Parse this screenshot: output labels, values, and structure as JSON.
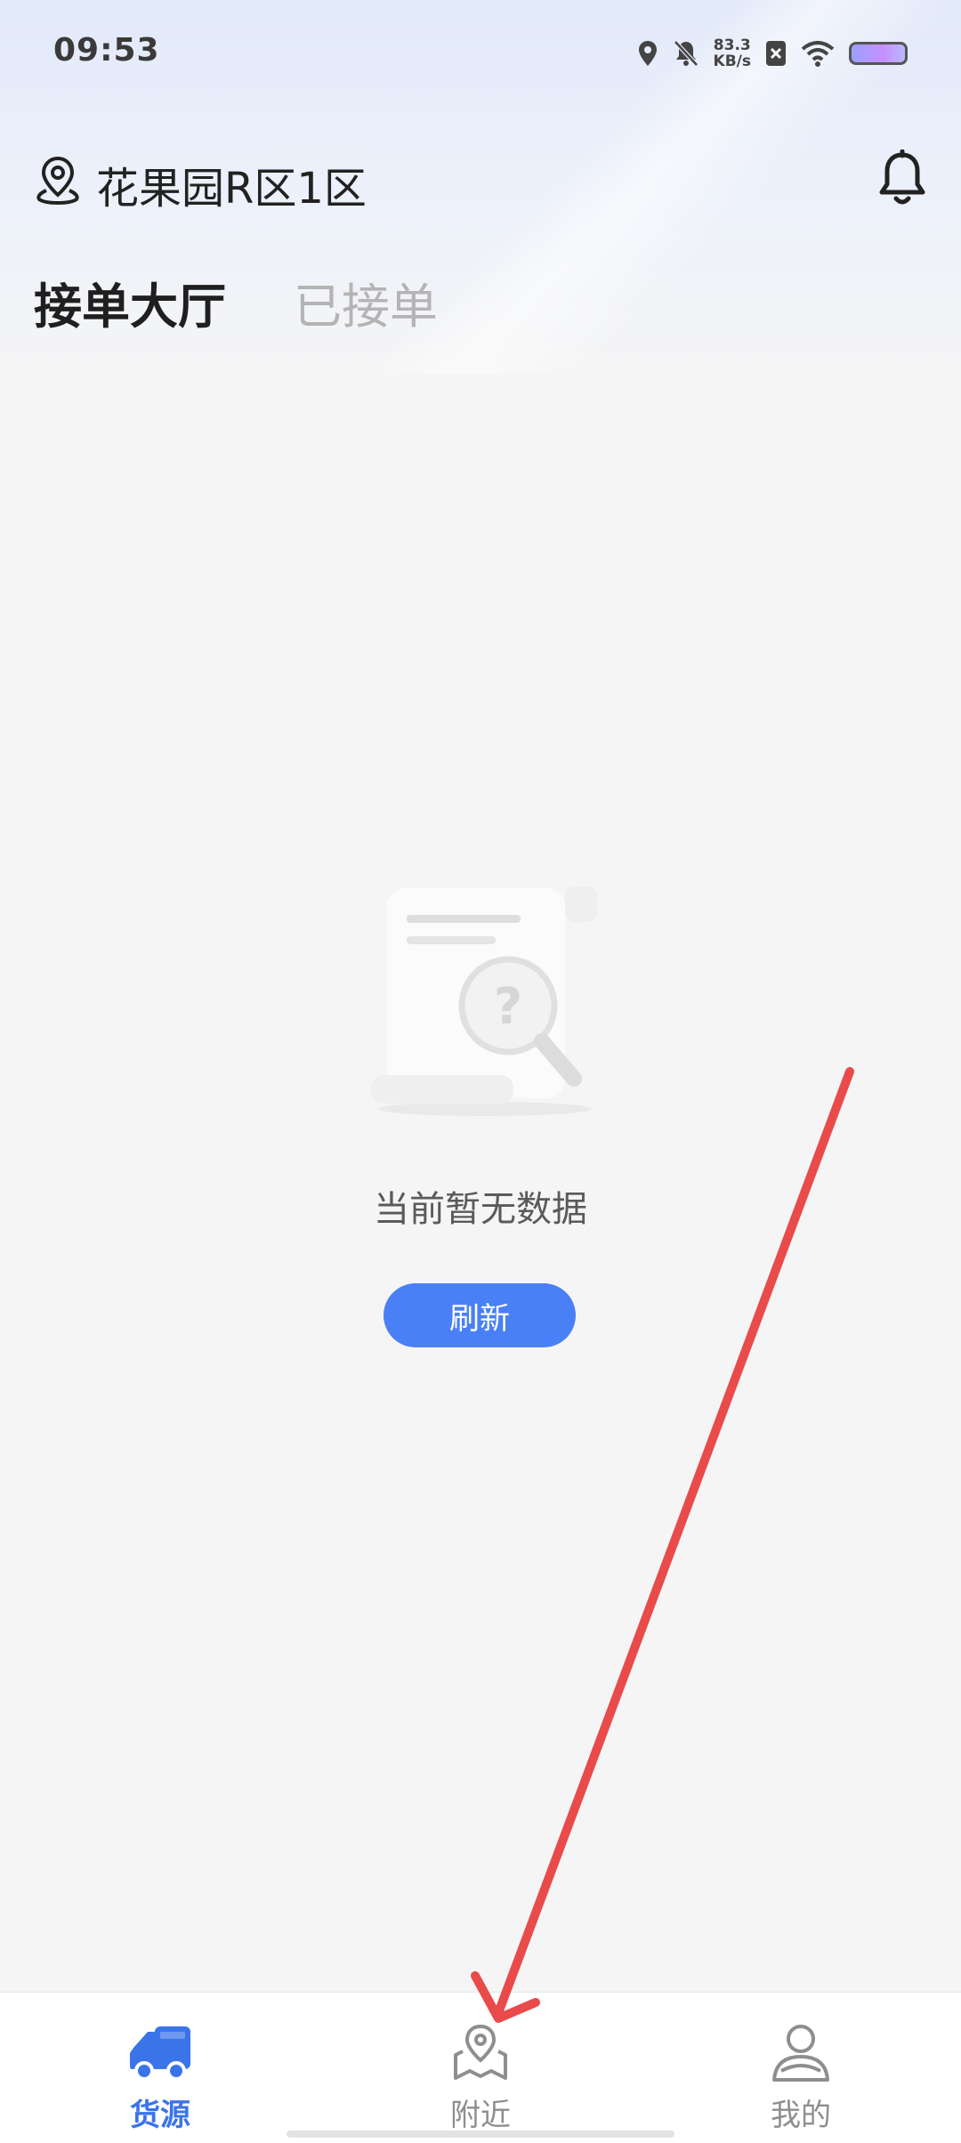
{
  "status_bar": {
    "time": "09:53",
    "speed_value": "83.3",
    "speed_unit": "KB/s",
    "icons": [
      "location-icon",
      "mute-bell-icon",
      "sim-off-icon",
      "wifi-icon",
      "battery-icon"
    ]
  },
  "header": {
    "location": "花果园R区1区",
    "location_icon": "location-pin-icon",
    "notification_icon": "bell-icon"
  },
  "tabs": [
    {
      "label": "接单大厅",
      "active": true
    },
    {
      "label": "已接单",
      "active": false
    }
  ],
  "empty_state": {
    "message": "当前暂无数据",
    "refresh_label": "刷新"
  },
  "bottom_nav": [
    {
      "label": "货源",
      "icon": "truck-icon",
      "active": true
    },
    {
      "label": "附近",
      "icon": "map-pin-icon",
      "active": false
    },
    {
      "label": "我的",
      "icon": "user-icon",
      "active": false
    }
  ],
  "colors": {
    "accent": "#4a80f5",
    "active_nav": "#3b74e8",
    "annotation_arrow": "#e94b4b"
  }
}
